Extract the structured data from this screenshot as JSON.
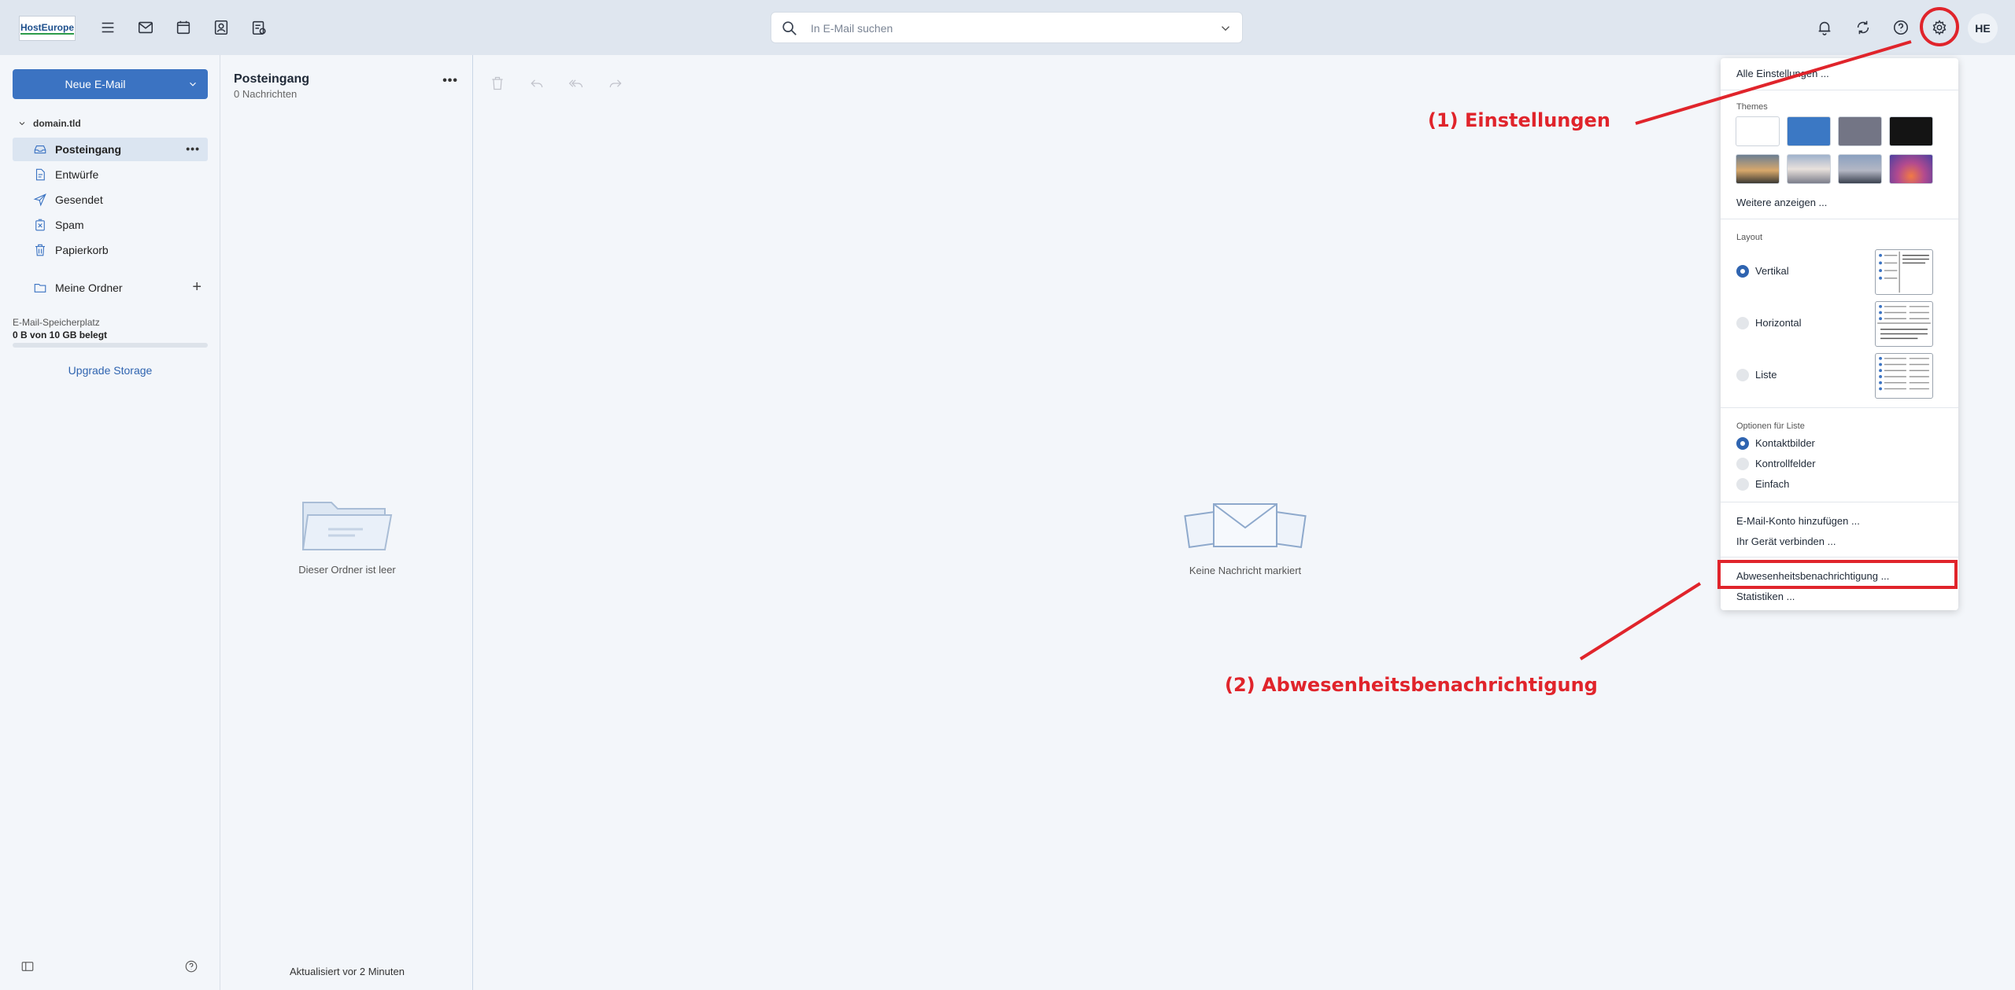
{
  "header": {
    "logo_text": "HostEurope",
    "search_placeholder": "In E-Mail suchen",
    "avatar_initials": "HE"
  },
  "sidebar": {
    "new_mail_label": "Neue E-Mail",
    "account": "domain.tld",
    "folders": [
      {
        "label": "Posteingang",
        "icon": "inbox-icon",
        "active": true
      },
      {
        "label": "Entwürfe",
        "icon": "draft-icon"
      },
      {
        "label": "Gesendet",
        "icon": "send-icon"
      },
      {
        "label": "Spam",
        "icon": "spam-icon"
      },
      {
        "label": "Papierkorb",
        "icon": "trash-icon"
      }
    ],
    "my_folders_label": "Meine Ordner",
    "storage_label": "E-Mail-Speicherplatz",
    "storage_used": "0 B von 10 GB belegt",
    "storage_fraction": 0,
    "upgrade_label": "Upgrade Storage"
  },
  "message_list": {
    "title": "Posteingang",
    "count": "0 Nachrichten",
    "empty_text": "Dieser Ordner ist leer",
    "updated_text": "Aktualisiert vor 2 Minuten"
  },
  "reader": {
    "empty_text": "Keine Nachricht markiert"
  },
  "settings_menu": {
    "all_settings": "Alle Einstellungen ...",
    "themes_label": "Themes",
    "theme_colors": [
      "#ffffff",
      "#3b78c4",
      "#737585",
      "#141414"
    ],
    "more_themes": "Weitere anzeigen ...",
    "layout_label": "Layout",
    "layout_options": [
      {
        "label": "Vertikal",
        "selected": true
      },
      {
        "label": "Horizontal",
        "selected": false
      },
      {
        "label": "Liste",
        "selected": false
      }
    ],
    "list_options_label": "Optionen für Liste",
    "list_options": [
      {
        "label": "Kontaktbilder",
        "selected": true
      },
      {
        "label": "Kontrollfelder",
        "selected": false
      },
      {
        "label": "Einfach",
        "selected": false
      }
    ],
    "add_account": "E-Mail-Konto hinzufügen ...",
    "connect_device": "Ihr Gerät verbinden ...",
    "out_of_office": "Abwesenheitsbenachrichtigung ...",
    "statistics": "Statistiken ..."
  },
  "annotations": {
    "step1": "(1) Einstellungen",
    "step2": "(2) Abwesenheitsbenachrichtigung",
    "accent_color": "#e0242b"
  }
}
